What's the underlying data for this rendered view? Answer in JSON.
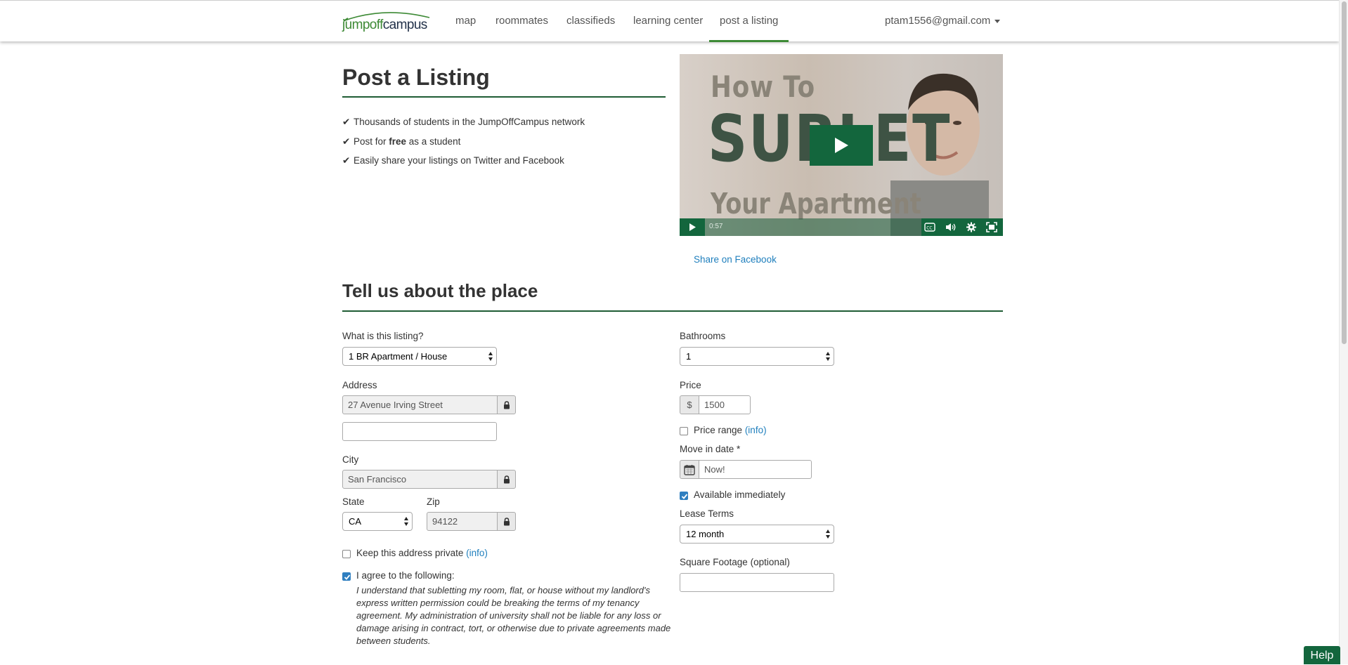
{
  "nav": {
    "logo": {
      "part1": "jump",
      "part2": "off",
      "part3": "campus"
    },
    "items": [
      {
        "label": "map"
      },
      {
        "label": "roommates"
      },
      {
        "label": "classifieds"
      },
      {
        "label": "learning center"
      },
      {
        "label": "post a listing"
      }
    ],
    "active_item": "post a listing",
    "user_email": "ptam1556@gmail.com"
  },
  "intro": {
    "title": "Post a Listing",
    "features": [
      {
        "pre": "Thousands of students in the JumpOffCampus network",
        "bold": "",
        "post": ""
      },
      {
        "pre": "Post for ",
        "bold": "free",
        "post": " as a student"
      },
      {
        "pre": "Easily share your listings on Twitter and Facebook",
        "bold": "",
        "post": ""
      }
    ]
  },
  "video": {
    "title_line1": "How To",
    "title_line2": "SUBLET",
    "title_line3": "Your Apartment",
    "time": "0:57",
    "share_label": "Share on Facebook"
  },
  "form": {
    "section_title": "Tell us about the place",
    "listing_type": {
      "label": "What is this listing?",
      "value": "1 BR Apartment / House"
    },
    "address": {
      "label": "Address",
      "line1": "27 Avenue Irving Street",
      "line2": ""
    },
    "city": {
      "label": "City",
      "value": "San Francisco"
    },
    "state": {
      "label": "State",
      "value": "CA"
    },
    "zip": {
      "label": "Zip",
      "value": "94122"
    },
    "keep_private": {
      "label": "Keep this address private",
      "info": "(info)",
      "checked": false
    },
    "agree": {
      "label": "I agree to the following:",
      "checked": true,
      "text": "I understand that subletting my room, flat, or house without my landlord's express written permission could be breaking the terms of my tenancy agreement. My administration of university shall not be liable for any loss or damage arising in contract, tort, or otherwise due to private agreements made between students."
    },
    "bathrooms": {
      "label": "Bathrooms",
      "value": "1"
    },
    "price": {
      "label": "Price",
      "currency": "$",
      "value": "1500"
    },
    "price_range": {
      "label": "Price range",
      "info": "(info)",
      "checked": false
    },
    "move_in": {
      "label": "Move in date *",
      "value": "Now!"
    },
    "available_immediately": {
      "label": "Available immediately",
      "checked": true
    },
    "lease_terms": {
      "label": "Lease Terms",
      "value": "12 month"
    },
    "square_footage": {
      "label": "Square Footage (optional)",
      "value": ""
    }
  },
  "help": {
    "label": "Help"
  },
  "colors": {
    "brand_green": "#13663d",
    "accent_green": "#3d8a35",
    "link_blue": "#1f7fbd",
    "checkbox_blue": "#2f7fc0"
  }
}
